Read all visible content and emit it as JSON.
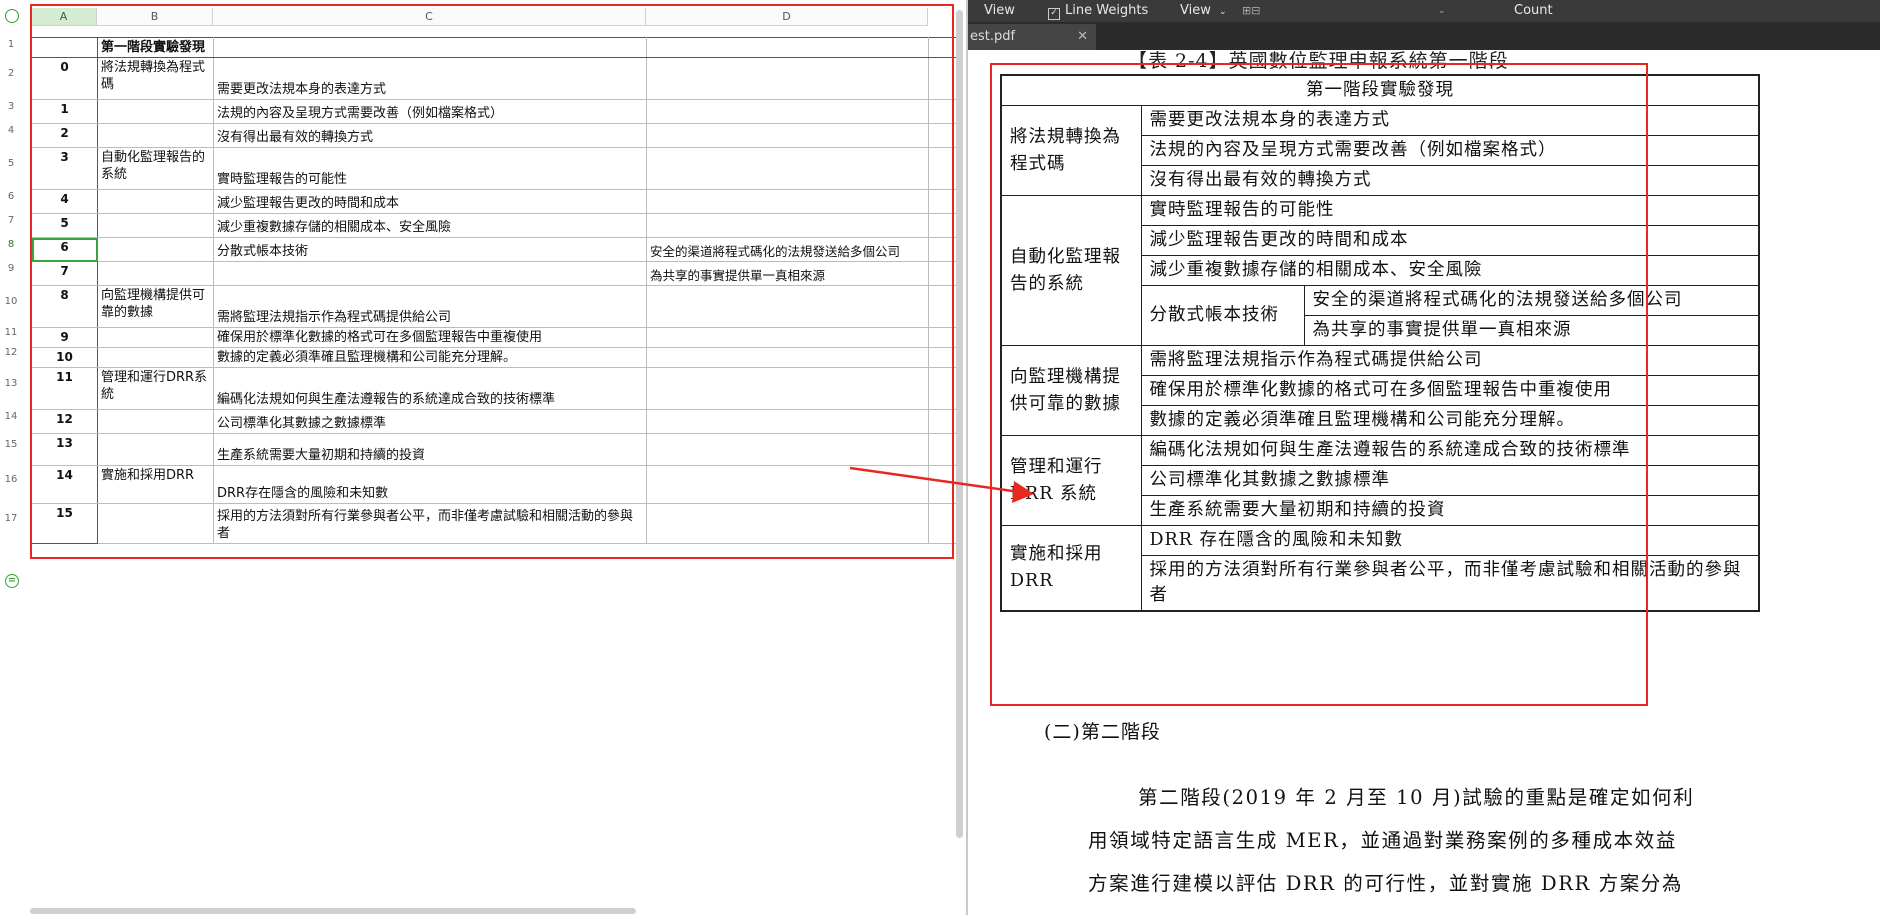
{
  "colors": {
    "annotation_red": "#e8281f",
    "selection_green": "#36a336",
    "toolbar_bg": "#3a3a3a"
  },
  "sheet": {
    "columns": [
      "A",
      "B",
      "C",
      "D"
    ],
    "row_numbers": [
      "1",
      "2",
      "3",
      "4",
      "5",
      "6",
      "7",
      "8",
      "9",
      "10",
      "11",
      "12",
      "13",
      "14",
      "15",
      "16",
      "17"
    ],
    "header": "第一階段實驗發現",
    "rows": [
      {
        "idx": "0",
        "cat": "將法規轉換為程式碼",
        "c": "需要更改法規本身的表達方式",
        "d": ""
      },
      {
        "idx": "1",
        "cat": "",
        "c": "法規的內容及呈現方式需要改善（例如檔案格式）",
        "d": ""
      },
      {
        "idx": "2",
        "cat": "",
        "c": "沒有得出最有效的轉換方式",
        "d": ""
      },
      {
        "idx": "3",
        "cat": "自動化監理報告的系統",
        "c": "實時監理報告的可能性",
        "d": ""
      },
      {
        "idx": "4",
        "cat": "",
        "c": "減少監理報告更改的時間和成本",
        "d": ""
      },
      {
        "idx": "5",
        "cat": "",
        "c": "減少重複數據存儲的相關成本、安全風險",
        "d": ""
      },
      {
        "idx": "6",
        "cat": "",
        "c": "分散式帳本技術",
        "d": "安全的渠道將程式碼化的法規發送給多個公司"
      },
      {
        "idx": "7",
        "cat": "",
        "c": "",
        "d": "為共享的事實提供單一真相來源"
      },
      {
        "idx": "8",
        "cat": "向監理機構提供可靠的數據",
        "c": "需將監理法規指示作為程式碼提供給公司",
        "d": ""
      },
      {
        "idx": "9",
        "cat": "",
        "c": "確保用於標準化數據的格式可在多個監理報告中重複使用",
        "d": ""
      },
      {
        "idx": "10",
        "cat": "",
        "c": "數據的定義必須準確且監理機構和公司能充分理解。",
        "d": ""
      },
      {
        "idx": "11",
        "cat": "管理和運行DRR系統",
        "c": "編碼化法規如何與生產法遵報告的系統達成合致的技術標準",
        "d": ""
      },
      {
        "idx": "12",
        "cat": "",
        "c": "公司標準化其數據之數據標準",
        "d": ""
      },
      {
        "idx": "13",
        "cat": "",
        "c": "生產系統需要大量初期和持續的投資",
        "d": ""
      },
      {
        "idx": "14",
        "cat": "實施和採用DRR",
        "c": "DRR存在隱含的風險和未知數",
        "d": ""
      },
      {
        "idx": "15",
        "cat": "",
        "c": "採用的方法須對所有行業參與者公平，而非僅考慮試驗和相關活動的參與者",
        "d": ""
      }
    ]
  },
  "pdf": {
    "toolbar": {
      "view1": "View",
      "line_weights": "Line Weights",
      "view2": "View",
      "count": "Count"
    },
    "tab_name": "est.pdf",
    "caption": "【表 2-4】英國數位監理申報系統第一階段",
    "table_title": "第一階段實驗發現",
    "groups": [
      {
        "cat": "將法規轉換為程式碼",
        "items": [
          "需要更改法規本身的表達方式",
          "法規的內容及呈現方式需要改善（例如檔案格式）",
          "沒有得出最有效的轉換方式"
        ]
      },
      {
        "cat": "自動化監理報告的系統",
        "items": [
          "實時監理報告的可能性",
          "減少監理報告更改的時間和成本",
          "減少重複數據存儲的相關成本、安全風險"
        ],
        "sub": {
          "label": "分散式帳本技術",
          "items": [
            "安全的渠道將程式碼化的法規發送給多個公司",
            "為共享的事實提供單一真相來源"
          ]
        }
      },
      {
        "cat": "向監理機構提供可靠的數據",
        "items": [
          "需將監理法規指示作為程式碼提供給公司",
          "確保用於標準化數據的格式可在多個監理報告中重複使用",
          "數據的定義必須準確且監理機構和公司能充分理解。"
        ]
      },
      {
        "cat": "管理和運行DRR 系統",
        "items": [
          "編碼化法規如何與生產法遵報告的系統達成合致的技術標準",
          "公司標準化其數據之數據標準",
          "生產系統需要大量初期和持續的投資"
        ]
      },
      {
        "cat": "實施和採用DRR",
        "items": [
          "DRR 存在隱含的風險和未知數",
          "採用的方法須對所有行業參與者公平，而非僅考慮試驗和相關活動的參與者"
        ]
      }
    ],
    "stage2_heading": "(二)第二階段",
    "paragraph_lines": [
      "第二階段(2019 年 2 月至 10 月)試驗的重點是確定如何利",
      "用領域特定語言生成 MER，並通過對業務案例的多種成本效益",
      "方案進行建模以評估 DRR 的可行性，並對實施 DRR 方案分為"
    ]
  }
}
